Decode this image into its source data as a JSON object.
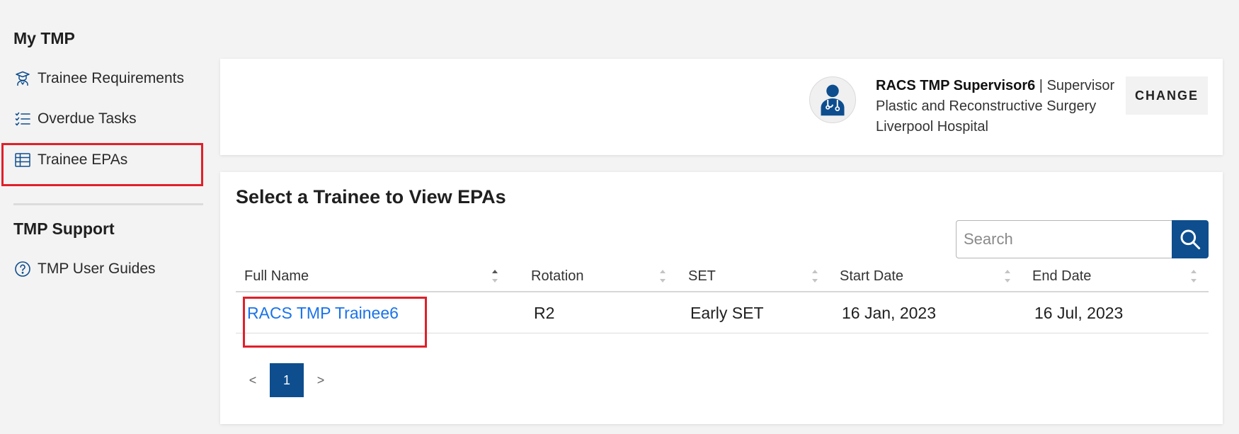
{
  "sidebar": {
    "heading": "My TMP",
    "items": [
      {
        "label": "Trainee Requirements",
        "icon": "graduate-icon"
      },
      {
        "label": "Overdue Tasks",
        "icon": "checklist-icon"
      },
      {
        "label": "Trainee EPAs",
        "icon": "table-icon"
      }
    ],
    "support_heading": "TMP Support",
    "support_items": [
      {
        "label": "TMP User Guides",
        "icon": "help-circle-icon"
      }
    ]
  },
  "profile": {
    "name": "RACS TMP Supervisor6",
    "separator": " | ",
    "role": "Supervisor",
    "specialty": "Plastic and Reconstructive Surgery",
    "hospital": "Liverpool Hospital",
    "change_label": "CHANGE",
    "avatar_icon": "doctor-avatar-icon"
  },
  "main": {
    "title": "Select a Trainee to View EPAs",
    "search": {
      "placeholder": "Search",
      "value": "",
      "icon": "search-icon"
    },
    "table": {
      "columns": [
        "Full Name",
        "Rotation",
        "SET",
        "Start Date",
        "End Date"
      ],
      "rows": [
        [
          "RACS TMP Trainee6",
          "R2",
          "Early SET",
          "16 Jan, 2023",
          "16 Jul, 2023"
        ]
      ]
    },
    "pagination": {
      "prev": "<",
      "current": "1",
      "next": ">"
    }
  },
  "colors": {
    "accent": "#0e4e8e",
    "link": "#1a73e8",
    "highlight": "#e0202a",
    "background": "#f3f3f3"
  }
}
